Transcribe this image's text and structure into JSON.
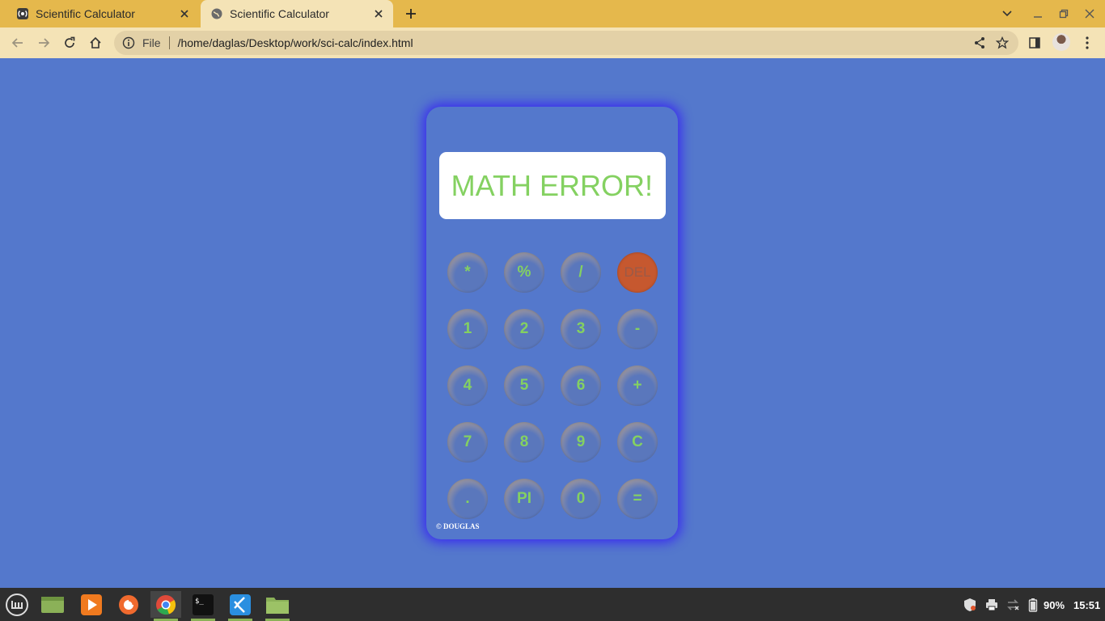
{
  "browser": {
    "tabs": [
      {
        "title": "Scientific Calculator",
        "active": false,
        "favicon": "radio-broadcast-icon"
      },
      {
        "title": "Scientific Calculator",
        "active": true,
        "favicon": "globe-icon"
      }
    ],
    "address": {
      "scheme_label": "File",
      "url": "/home/daglas/Desktop/work/sci-calc/index.html"
    },
    "colors": {
      "tabbar": "#e5b84c",
      "toolbar": "#f4e3b6",
      "omnibox": "#e3d1a7"
    }
  },
  "calculator": {
    "display": "MATH ERROR!",
    "keys": [
      [
        "*",
        "%",
        "/",
        "DEL"
      ],
      [
        "1",
        "2",
        "3",
        "-"
      ],
      [
        "4",
        "5",
        "6",
        "+"
      ],
      [
        "7",
        "8",
        "9",
        "C"
      ],
      [
        ".",
        "PI",
        "0",
        "="
      ]
    ],
    "credit": "© DOUGLAS",
    "colors": {
      "page_bg": "#5478cc",
      "glow": "#3a2cf0",
      "key_text": "#84d161",
      "del_bg": "#c6582f"
    }
  },
  "taskbar": {
    "apps": [
      {
        "name": "menu-icon",
        "active": false
      },
      {
        "name": "show-desktop-icon",
        "active": false
      },
      {
        "name": "media-player-icon",
        "active": false
      },
      {
        "name": "firefox-icon",
        "active": false
      },
      {
        "name": "chrome-icon",
        "active": true
      },
      {
        "name": "terminal-icon",
        "active": true
      },
      {
        "name": "vscode-icon",
        "active": true
      },
      {
        "name": "files-icon",
        "active": true
      }
    ],
    "battery": "90%",
    "clock": "15:51"
  }
}
